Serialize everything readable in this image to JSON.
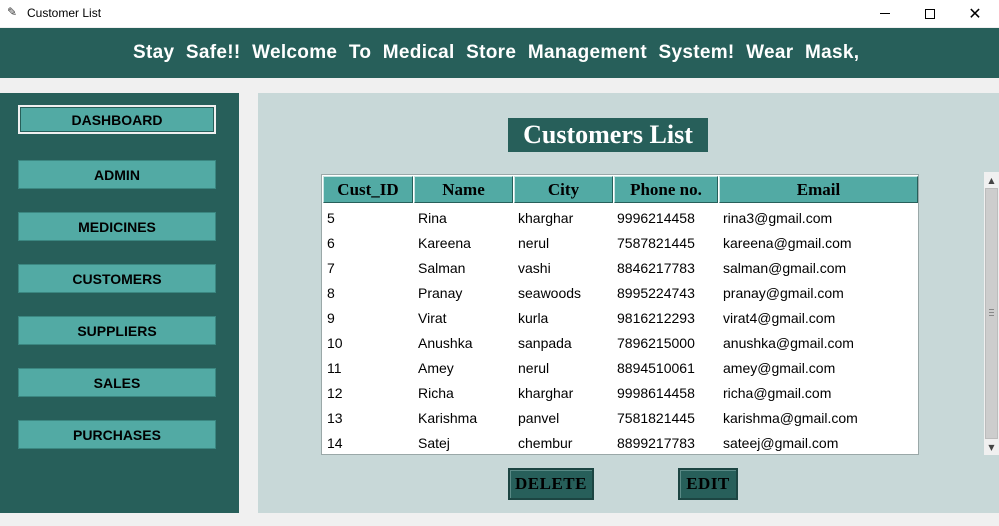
{
  "window": {
    "title": "Customer List",
    "app_icon": "feather-icon",
    "controls": {
      "minimize": "minimize-icon",
      "maximize": "maximize-icon",
      "close": "✕"
    }
  },
  "banner": {
    "text": "Stay Safe!!  Welcome To Medical Store Management System! Wear Mask,"
  },
  "sidebar": {
    "items": [
      {
        "label": "DASHBOARD"
      },
      {
        "label": "ADMIN"
      },
      {
        "label": "MEDICINES"
      },
      {
        "label": "CUSTOMERS"
      },
      {
        "label": "SUPPLIERS"
      },
      {
        "label": "SALES"
      },
      {
        "label": "PURCHASES"
      }
    ]
  },
  "main": {
    "title": "Customers List",
    "table": {
      "headers": [
        "Cust_ID",
        "Name",
        "City",
        "Phone no.",
        "Email"
      ],
      "rows": [
        [
          "5",
          "Rina",
          "kharghar",
          "9996214458",
          "rina3@gmail.com"
        ],
        [
          "6",
          "Kareena",
          "nerul",
          "7587821445",
          "kareena@gmail.com"
        ],
        [
          "7",
          "Salman",
          "vashi",
          "8846217783",
          "salman@gmail.com"
        ],
        [
          "8",
          "Pranay",
          "seawoods",
          "8995224743",
          "pranay@gmail.com"
        ],
        [
          "9",
          "Virat",
          "kurla",
          "9816212293",
          "virat4@gmail.com"
        ],
        [
          "10",
          "Anushka",
          "sanpada",
          "7896215000",
          "anushka@gmail.com"
        ],
        [
          "11",
          "Amey",
          "nerul",
          "8894510061",
          "amey@gmail.com"
        ],
        [
          "12",
          "Richa",
          "kharghar",
          "9998614458",
          "richa@gmail.com"
        ],
        [
          "13",
          "Karishma",
          "panvel",
          "7581821445",
          "karishma@gmail.com"
        ],
        [
          "14",
          "Satej",
          "chembur",
          "8899217783",
          "sateej@gmail.com"
        ]
      ]
    },
    "actions": {
      "delete_label": "DELETE",
      "edit_label": "EDIT"
    }
  },
  "colors": {
    "primary_dark": "#275f5a",
    "accent_teal": "#52aaa4",
    "panel_bg": "#c8d8d8"
  }
}
